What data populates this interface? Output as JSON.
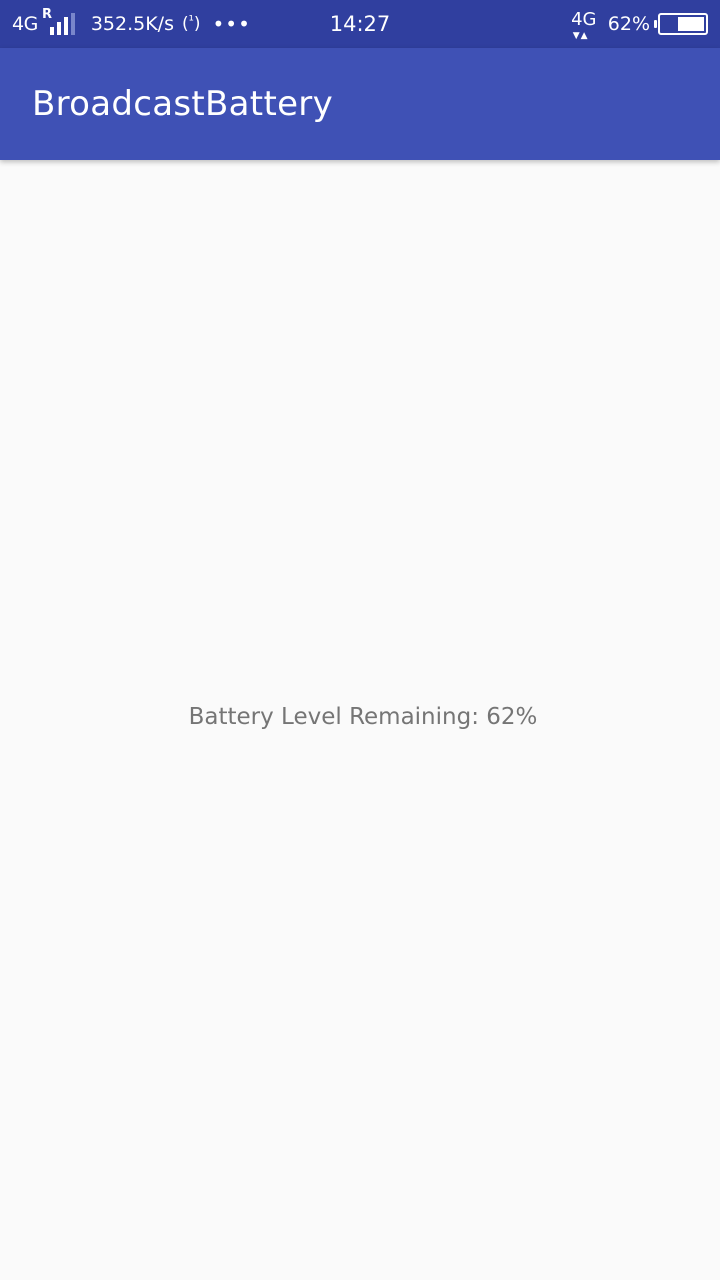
{
  "status_bar": {
    "network_type": "4G",
    "roaming": "R",
    "signal_level": 0.75,
    "net_speed": "352.5K/s",
    "hotspot_icon": "hotspot-icon",
    "more": "•••",
    "time": "14:27",
    "data_type": "4G",
    "data_arrows": "▼▲",
    "battery_percent_text": "62%",
    "battery_level": 0.62
  },
  "app_bar": {
    "title": "BroadcastBattery",
    "color": "#3f51b5",
    "status_color": "#303f9f"
  },
  "main": {
    "battery_text": "Battery Level Remaining: 62%"
  }
}
